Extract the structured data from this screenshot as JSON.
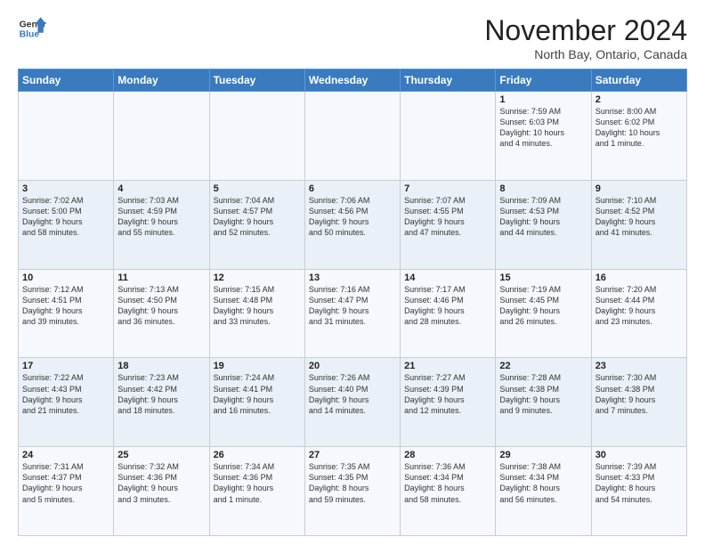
{
  "logo": {
    "line1": "General",
    "line2": "Blue"
  },
  "title": "November 2024",
  "location": "North Bay, Ontario, Canada",
  "days_header": [
    "Sunday",
    "Monday",
    "Tuesday",
    "Wednesday",
    "Thursday",
    "Friday",
    "Saturday"
  ],
  "weeks": [
    [
      {
        "day": "",
        "info": ""
      },
      {
        "day": "",
        "info": ""
      },
      {
        "day": "",
        "info": ""
      },
      {
        "day": "",
        "info": ""
      },
      {
        "day": "",
        "info": ""
      },
      {
        "day": "1",
        "info": "Sunrise: 7:59 AM\nSunset: 6:03 PM\nDaylight: 10 hours\nand 4 minutes."
      },
      {
        "day": "2",
        "info": "Sunrise: 8:00 AM\nSunset: 6:02 PM\nDaylight: 10 hours\nand 1 minute."
      }
    ],
    [
      {
        "day": "3",
        "info": "Sunrise: 7:02 AM\nSunset: 5:00 PM\nDaylight: 9 hours\nand 58 minutes."
      },
      {
        "day": "4",
        "info": "Sunrise: 7:03 AM\nSunset: 4:59 PM\nDaylight: 9 hours\nand 55 minutes."
      },
      {
        "day": "5",
        "info": "Sunrise: 7:04 AM\nSunset: 4:57 PM\nDaylight: 9 hours\nand 52 minutes."
      },
      {
        "day": "6",
        "info": "Sunrise: 7:06 AM\nSunset: 4:56 PM\nDaylight: 9 hours\nand 50 minutes."
      },
      {
        "day": "7",
        "info": "Sunrise: 7:07 AM\nSunset: 4:55 PM\nDaylight: 9 hours\nand 47 minutes."
      },
      {
        "day": "8",
        "info": "Sunrise: 7:09 AM\nSunset: 4:53 PM\nDaylight: 9 hours\nand 44 minutes."
      },
      {
        "day": "9",
        "info": "Sunrise: 7:10 AM\nSunset: 4:52 PM\nDaylight: 9 hours\nand 41 minutes."
      }
    ],
    [
      {
        "day": "10",
        "info": "Sunrise: 7:12 AM\nSunset: 4:51 PM\nDaylight: 9 hours\nand 39 minutes."
      },
      {
        "day": "11",
        "info": "Sunrise: 7:13 AM\nSunset: 4:50 PM\nDaylight: 9 hours\nand 36 minutes."
      },
      {
        "day": "12",
        "info": "Sunrise: 7:15 AM\nSunset: 4:48 PM\nDaylight: 9 hours\nand 33 minutes."
      },
      {
        "day": "13",
        "info": "Sunrise: 7:16 AM\nSunset: 4:47 PM\nDaylight: 9 hours\nand 31 minutes."
      },
      {
        "day": "14",
        "info": "Sunrise: 7:17 AM\nSunset: 4:46 PM\nDaylight: 9 hours\nand 28 minutes."
      },
      {
        "day": "15",
        "info": "Sunrise: 7:19 AM\nSunset: 4:45 PM\nDaylight: 9 hours\nand 26 minutes."
      },
      {
        "day": "16",
        "info": "Sunrise: 7:20 AM\nSunset: 4:44 PM\nDaylight: 9 hours\nand 23 minutes."
      }
    ],
    [
      {
        "day": "17",
        "info": "Sunrise: 7:22 AM\nSunset: 4:43 PM\nDaylight: 9 hours\nand 21 minutes."
      },
      {
        "day": "18",
        "info": "Sunrise: 7:23 AM\nSunset: 4:42 PM\nDaylight: 9 hours\nand 18 minutes."
      },
      {
        "day": "19",
        "info": "Sunrise: 7:24 AM\nSunset: 4:41 PM\nDaylight: 9 hours\nand 16 minutes."
      },
      {
        "day": "20",
        "info": "Sunrise: 7:26 AM\nSunset: 4:40 PM\nDaylight: 9 hours\nand 14 minutes."
      },
      {
        "day": "21",
        "info": "Sunrise: 7:27 AM\nSunset: 4:39 PM\nDaylight: 9 hours\nand 12 minutes."
      },
      {
        "day": "22",
        "info": "Sunrise: 7:28 AM\nSunset: 4:38 PM\nDaylight: 9 hours\nand 9 minutes."
      },
      {
        "day": "23",
        "info": "Sunrise: 7:30 AM\nSunset: 4:38 PM\nDaylight: 9 hours\nand 7 minutes."
      }
    ],
    [
      {
        "day": "24",
        "info": "Sunrise: 7:31 AM\nSunset: 4:37 PM\nDaylight: 9 hours\nand 5 minutes."
      },
      {
        "day": "25",
        "info": "Sunrise: 7:32 AM\nSunset: 4:36 PM\nDaylight: 9 hours\nand 3 minutes."
      },
      {
        "day": "26",
        "info": "Sunrise: 7:34 AM\nSunset: 4:36 PM\nDaylight: 9 hours\nand 1 minute."
      },
      {
        "day": "27",
        "info": "Sunrise: 7:35 AM\nSunset: 4:35 PM\nDaylight: 8 hours\nand 59 minutes."
      },
      {
        "day": "28",
        "info": "Sunrise: 7:36 AM\nSunset: 4:34 PM\nDaylight: 8 hours\nand 58 minutes."
      },
      {
        "day": "29",
        "info": "Sunrise: 7:38 AM\nSunset: 4:34 PM\nDaylight: 8 hours\nand 56 minutes."
      },
      {
        "day": "30",
        "info": "Sunrise: 7:39 AM\nSunset: 4:33 PM\nDaylight: 8 hours\nand 54 minutes."
      }
    ]
  ]
}
